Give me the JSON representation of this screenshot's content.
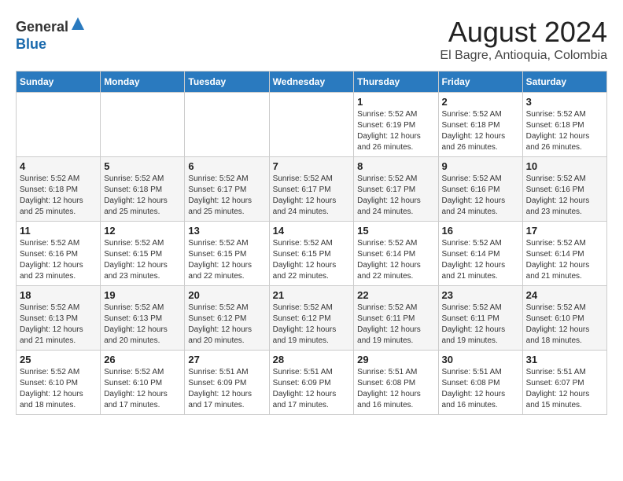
{
  "header": {
    "logo_line1": "General",
    "logo_line2": "Blue",
    "month_title": "August 2024",
    "location": "El Bagre, Antioquia, Colombia"
  },
  "days_of_week": [
    "Sunday",
    "Monday",
    "Tuesday",
    "Wednesday",
    "Thursday",
    "Friday",
    "Saturday"
  ],
  "weeks": [
    [
      {
        "day": "",
        "info": ""
      },
      {
        "day": "",
        "info": ""
      },
      {
        "day": "",
        "info": ""
      },
      {
        "day": "",
        "info": ""
      },
      {
        "day": "1",
        "info": "Sunrise: 5:52 AM\nSunset: 6:19 PM\nDaylight: 12 hours\nand 26 minutes."
      },
      {
        "day": "2",
        "info": "Sunrise: 5:52 AM\nSunset: 6:18 PM\nDaylight: 12 hours\nand 26 minutes."
      },
      {
        "day": "3",
        "info": "Sunrise: 5:52 AM\nSunset: 6:18 PM\nDaylight: 12 hours\nand 26 minutes."
      }
    ],
    [
      {
        "day": "4",
        "info": "Sunrise: 5:52 AM\nSunset: 6:18 PM\nDaylight: 12 hours\nand 25 minutes."
      },
      {
        "day": "5",
        "info": "Sunrise: 5:52 AM\nSunset: 6:18 PM\nDaylight: 12 hours\nand 25 minutes."
      },
      {
        "day": "6",
        "info": "Sunrise: 5:52 AM\nSunset: 6:17 PM\nDaylight: 12 hours\nand 25 minutes."
      },
      {
        "day": "7",
        "info": "Sunrise: 5:52 AM\nSunset: 6:17 PM\nDaylight: 12 hours\nand 24 minutes."
      },
      {
        "day": "8",
        "info": "Sunrise: 5:52 AM\nSunset: 6:17 PM\nDaylight: 12 hours\nand 24 minutes."
      },
      {
        "day": "9",
        "info": "Sunrise: 5:52 AM\nSunset: 6:16 PM\nDaylight: 12 hours\nand 24 minutes."
      },
      {
        "day": "10",
        "info": "Sunrise: 5:52 AM\nSunset: 6:16 PM\nDaylight: 12 hours\nand 23 minutes."
      }
    ],
    [
      {
        "day": "11",
        "info": "Sunrise: 5:52 AM\nSunset: 6:16 PM\nDaylight: 12 hours\nand 23 minutes."
      },
      {
        "day": "12",
        "info": "Sunrise: 5:52 AM\nSunset: 6:15 PM\nDaylight: 12 hours\nand 23 minutes."
      },
      {
        "day": "13",
        "info": "Sunrise: 5:52 AM\nSunset: 6:15 PM\nDaylight: 12 hours\nand 22 minutes."
      },
      {
        "day": "14",
        "info": "Sunrise: 5:52 AM\nSunset: 6:15 PM\nDaylight: 12 hours\nand 22 minutes."
      },
      {
        "day": "15",
        "info": "Sunrise: 5:52 AM\nSunset: 6:14 PM\nDaylight: 12 hours\nand 22 minutes."
      },
      {
        "day": "16",
        "info": "Sunrise: 5:52 AM\nSunset: 6:14 PM\nDaylight: 12 hours\nand 21 minutes."
      },
      {
        "day": "17",
        "info": "Sunrise: 5:52 AM\nSunset: 6:14 PM\nDaylight: 12 hours\nand 21 minutes."
      }
    ],
    [
      {
        "day": "18",
        "info": "Sunrise: 5:52 AM\nSunset: 6:13 PM\nDaylight: 12 hours\nand 21 minutes."
      },
      {
        "day": "19",
        "info": "Sunrise: 5:52 AM\nSunset: 6:13 PM\nDaylight: 12 hours\nand 20 minutes."
      },
      {
        "day": "20",
        "info": "Sunrise: 5:52 AM\nSunset: 6:12 PM\nDaylight: 12 hours\nand 20 minutes."
      },
      {
        "day": "21",
        "info": "Sunrise: 5:52 AM\nSunset: 6:12 PM\nDaylight: 12 hours\nand 19 minutes."
      },
      {
        "day": "22",
        "info": "Sunrise: 5:52 AM\nSunset: 6:11 PM\nDaylight: 12 hours\nand 19 minutes."
      },
      {
        "day": "23",
        "info": "Sunrise: 5:52 AM\nSunset: 6:11 PM\nDaylight: 12 hours\nand 19 minutes."
      },
      {
        "day": "24",
        "info": "Sunrise: 5:52 AM\nSunset: 6:10 PM\nDaylight: 12 hours\nand 18 minutes."
      }
    ],
    [
      {
        "day": "25",
        "info": "Sunrise: 5:52 AM\nSunset: 6:10 PM\nDaylight: 12 hours\nand 18 minutes."
      },
      {
        "day": "26",
        "info": "Sunrise: 5:52 AM\nSunset: 6:10 PM\nDaylight: 12 hours\nand 17 minutes."
      },
      {
        "day": "27",
        "info": "Sunrise: 5:51 AM\nSunset: 6:09 PM\nDaylight: 12 hours\nand 17 minutes."
      },
      {
        "day": "28",
        "info": "Sunrise: 5:51 AM\nSunset: 6:09 PM\nDaylight: 12 hours\nand 17 minutes."
      },
      {
        "day": "29",
        "info": "Sunrise: 5:51 AM\nSunset: 6:08 PM\nDaylight: 12 hours\nand 16 minutes."
      },
      {
        "day": "30",
        "info": "Sunrise: 5:51 AM\nSunset: 6:08 PM\nDaylight: 12 hours\nand 16 minutes."
      },
      {
        "day": "31",
        "info": "Sunrise: 5:51 AM\nSunset: 6:07 PM\nDaylight: 12 hours\nand 15 minutes."
      }
    ]
  ]
}
